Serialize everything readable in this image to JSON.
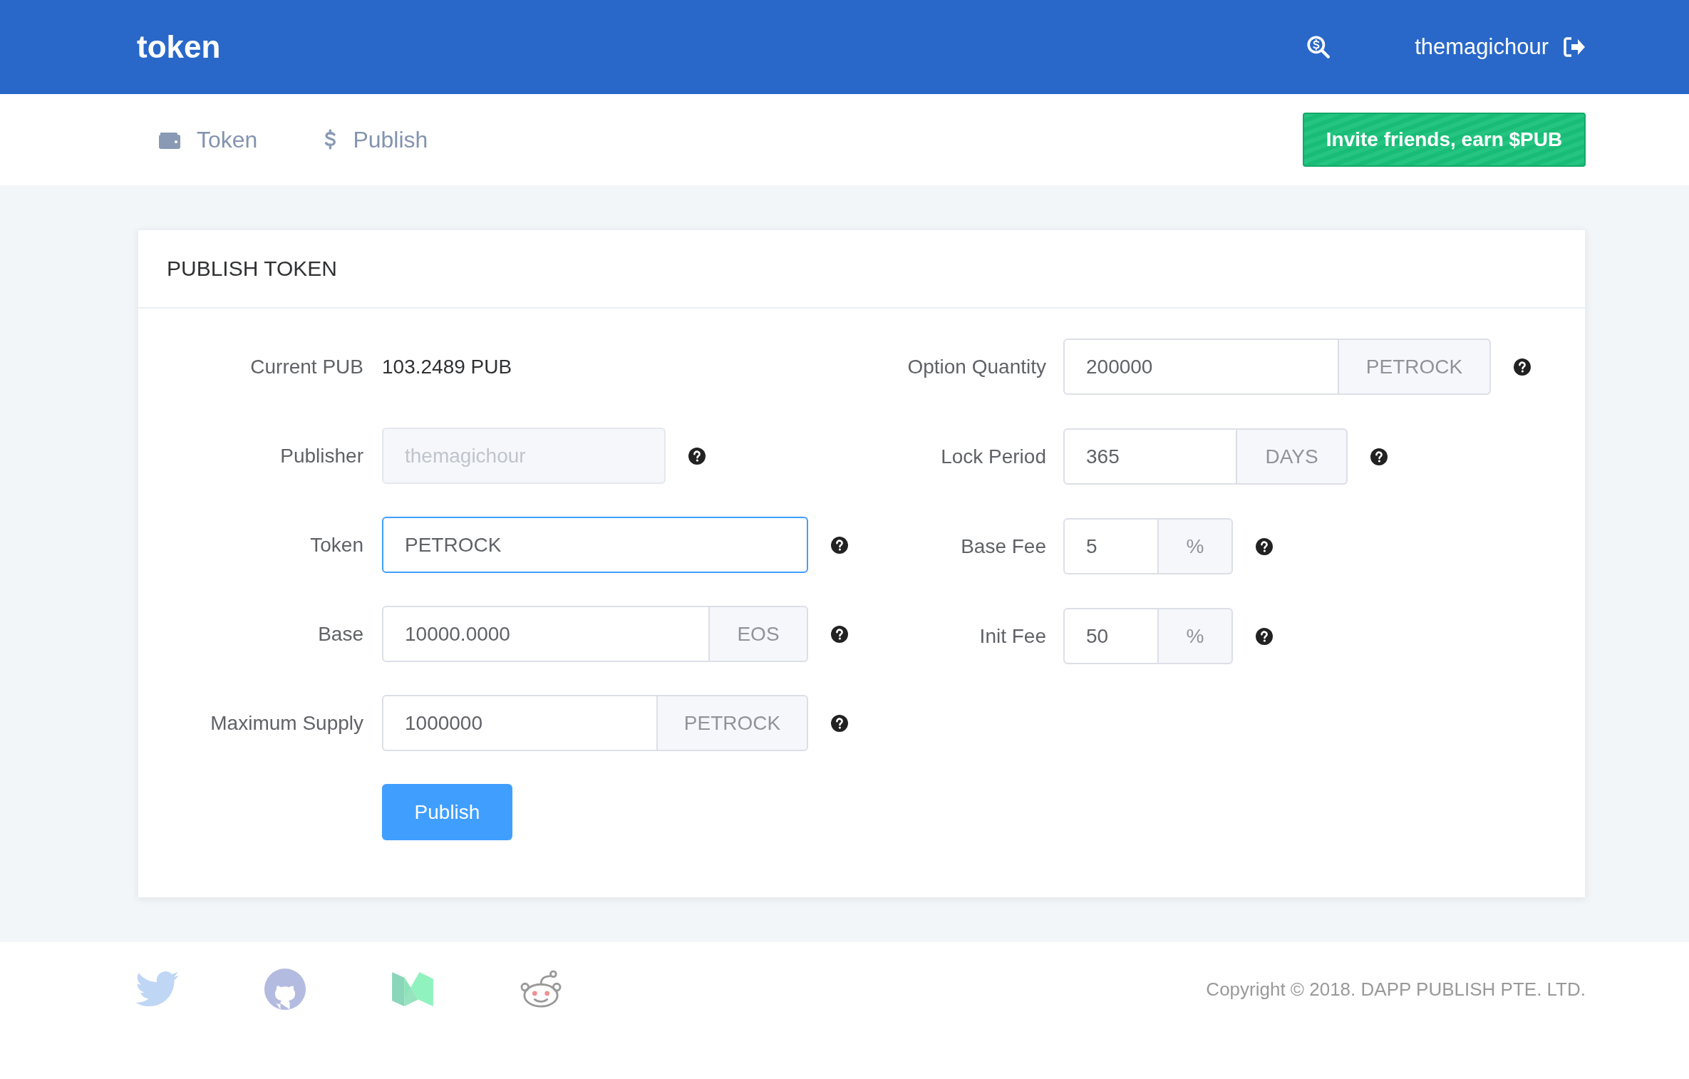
{
  "header": {
    "logo": "token",
    "username": "themagichour"
  },
  "nav": {
    "tabs": [
      {
        "label": "Token",
        "selected": false
      },
      {
        "label": "Publish",
        "selected": false
      }
    ],
    "invite_button": "Invite friends, earn $PUB"
  },
  "card": {
    "title": "PUBLISH TOKEN",
    "left_fields": [
      {
        "kind": "static",
        "label": "Current PUB",
        "value": "103.2489 PUB",
        "help": false
      },
      {
        "kind": "input",
        "label": "Publisher",
        "value": "themagichour",
        "disabled": true,
        "focused": false,
        "help": true
      },
      {
        "kind": "input",
        "label": "Token",
        "value": "PETROCK",
        "disabled": false,
        "focused": true,
        "help": true
      },
      {
        "kind": "input_addon",
        "label": "Base",
        "value": "10000.0000",
        "addon": "EOS",
        "disabled": false,
        "focused": false,
        "help": true
      },
      {
        "kind": "input_addon",
        "label": "Maximum Supply",
        "value": "1000000",
        "addon": "PETROCK",
        "disabled": false,
        "focused": false,
        "help": true
      }
    ],
    "right_fields": [
      {
        "kind": "input_addon",
        "label": "Option Quantity",
        "value": "200000",
        "addon": "PETROCK",
        "disabled": false,
        "focused": false,
        "help": true
      },
      {
        "kind": "input_addon",
        "label": "Lock Period",
        "value": "365",
        "addon": "DAYS",
        "disabled": false,
        "focused": false,
        "help": true
      },
      {
        "kind": "input_addon",
        "label": "Base Fee",
        "value": "5",
        "addon": "%",
        "disabled": false,
        "focused": false,
        "help": true
      },
      {
        "kind": "input_addon",
        "label": "Init Fee",
        "value": "50",
        "addon": "%",
        "disabled": false,
        "focused": false,
        "help": true
      }
    ],
    "publish_button": "Publish"
  },
  "footer": {
    "copyright": "Copyright © 2018. DAPP PUBLISH PTE. LTD."
  }
}
